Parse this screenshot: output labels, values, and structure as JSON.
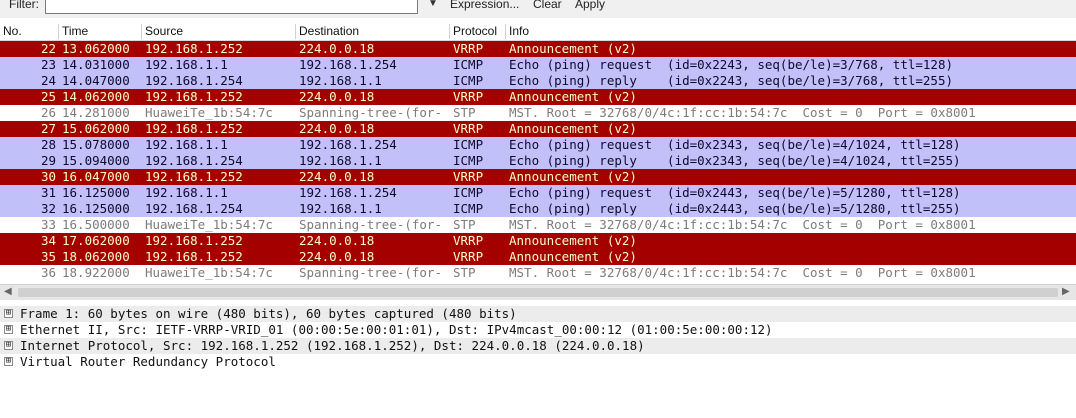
{
  "filter_bar": {
    "label": "Filter:",
    "value": "",
    "dropdown_icon": "dropdown-arrow",
    "expression_label": "Expression...",
    "clear_label": "Clear",
    "apply_label": "Apply"
  },
  "columns": {
    "no": "No.",
    "time": "Time",
    "source": "Source",
    "destination": "Destination",
    "protocol": "Protocol",
    "info": "Info"
  },
  "packets": [
    {
      "no": "22",
      "time": "13.062000",
      "source": "192.168.1.252",
      "destination": "224.0.0.18",
      "protocol": "VRRP",
      "info": "Announcement (v2)"
    },
    {
      "no": "23",
      "time": "14.031000",
      "source": "192.168.1.1",
      "destination": "192.168.1.254",
      "protocol": "ICMP",
      "info": "Echo (ping) request  (id=0x2243, seq(be/le)=3/768, ttl=128)"
    },
    {
      "no": "24",
      "time": "14.047000",
      "source": "192.168.1.254",
      "destination": "192.168.1.1",
      "protocol": "ICMP",
      "info": "Echo (ping) reply    (id=0x2243, seq(be/le)=3/768, ttl=255)"
    },
    {
      "no": "25",
      "time": "14.062000",
      "source": "192.168.1.252",
      "destination": "224.0.0.18",
      "protocol": "VRRP",
      "info": "Announcement (v2)"
    },
    {
      "no": "26",
      "time": "14.281000",
      "source": "HuaweiTe_1b:54:7c",
      "destination": "Spanning-tree-(for-",
      "protocol": "STP",
      "info": "MST. Root = 32768/0/4c:1f:cc:1b:54:7c  Cost = 0  Port = 0x8001"
    },
    {
      "no": "27",
      "time": "15.062000",
      "source": "192.168.1.252",
      "destination": "224.0.0.18",
      "protocol": "VRRP",
      "info": "Announcement (v2)"
    },
    {
      "no": "28",
      "time": "15.078000",
      "source": "192.168.1.1",
      "destination": "192.168.1.254",
      "protocol": "ICMP",
      "info": "Echo (ping) request  (id=0x2343, seq(be/le)=4/1024, ttl=128)"
    },
    {
      "no": "29",
      "time": "15.094000",
      "source": "192.168.1.254",
      "destination": "192.168.1.1",
      "protocol": "ICMP",
      "info": "Echo (ping) reply    (id=0x2343, seq(be/le)=4/1024, ttl=255)"
    },
    {
      "no": "30",
      "time": "16.047000",
      "source": "192.168.1.252",
      "destination": "224.0.0.18",
      "protocol": "VRRP",
      "info": "Announcement (v2)"
    },
    {
      "no": "31",
      "time": "16.125000",
      "source": "192.168.1.1",
      "destination": "192.168.1.254",
      "protocol": "ICMP",
      "info": "Echo (ping) request  (id=0x2443, seq(be/le)=5/1280, ttl=128)"
    },
    {
      "no": "32",
      "time": "16.125000",
      "source": "192.168.1.254",
      "destination": "192.168.1.1",
      "protocol": "ICMP",
      "info": "Echo (ping) reply    (id=0x2443, seq(be/le)=5/1280, ttl=255)"
    },
    {
      "no": "33",
      "time": "16.500000",
      "source": "HuaweiTe_1b:54:7c",
      "destination": "Spanning-tree-(for-",
      "protocol": "STP",
      "info": "MST. Root = 32768/0/4c:1f:cc:1b:54:7c  Cost = 0  Port = 0x8001"
    },
    {
      "no": "34",
      "time": "17.062000",
      "source": "192.168.1.252",
      "destination": "224.0.0.18",
      "protocol": "VRRP",
      "info": "Announcement (v2)"
    },
    {
      "no": "35",
      "time": "18.062000",
      "source": "192.168.1.252",
      "destination": "224.0.0.18",
      "protocol": "VRRP",
      "info": "Announcement (v2)"
    },
    {
      "no": "36",
      "time": "18.922000",
      "source": "HuaweiTe_1b:54:7c",
      "destination": "Spanning-tree-(for-",
      "protocol": "STP",
      "info": "MST. Root = 32768/0/4c:1f:cc:1b:54:7c  Cost = 0  Port = 0x8001"
    }
  ],
  "details": [
    {
      "expander": "⊞",
      "text": "Frame 1: 60 bytes on wire (480 bits), 60 bytes captured (480 bits)"
    },
    {
      "expander": "⊞",
      "text": "Ethernet II, Src: IETF-VRRP-VRID_01 (00:00:5e:00:01:01), Dst: IPv4mcast_00:00:12 (01:00:5e:00:00:12)"
    },
    {
      "expander": "⊞",
      "text": "Internet Protocol, Src: 192.168.1.252 (192.168.1.252), Dst: 224.0.0.18 (224.0.0.18)"
    },
    {
      "expander": "⊞",
      "text": "Virtual Router Redundancy Protocol"
    }
  ],
  "colors": {
    "vrrp_bg": "#a40000",
    "vrrp_fg": "#fffccc",
    "icmp_bg": "#c2c0f8",
    "icmp_fg": "#0c0c2c",
    "stp_bg": "#ffffff",
    "stp_fg": "#7c7c7c"
  }
}
